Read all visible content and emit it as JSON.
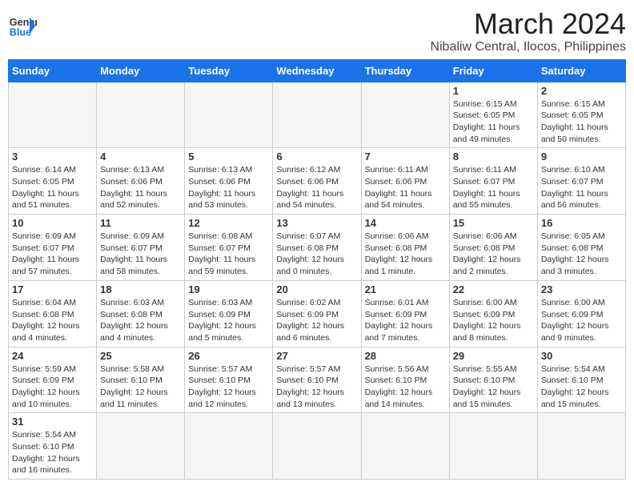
{
  "header": {
    "logo_general": "General",
    "logo_blue": "Blue",
    "month_year": "March 2024",
    "location": "Nibaliw Central, Ilocos, Philippines"
  },
  "weekdays": [
    "Sunday",
    "Monday",
    "Tuesday",
    "Wednesday",
    "Thursday",
    "Friday",
    "Saturday"
  ],
  "days": [
    {
      "num": "",
      "sunrise": "",
      "sunset": "",
      "daylight": "",
      "empty": true
    },
    {
      "num": "",
      "sunrise": "",
      "sunset": "",
      "daylight": "",
      "empty": true
    },
    {
      "num": "",
      "sunrise": "",
      "sunset": "",
      "daylight": "",
      "empty": true
    },
    {
      "num": "",
      "sunrise": "",
      "sunset": "",
      "daylight": "",
      "empty": true
    },
    {
      "num": "",
      "sunrise": "",
      "sunset": "",
      "daylight": "",
      "empty": true
    },
    {
      "num": "1",
      "sunrise": "Sunrise: 6:15 AM",
      "sunset": "Sunset: 6:05 PM",
      "daylight": "Daylight: 11 hours and 49 minutes."
    },
    {
      "num": "2",
      "sunrise": "Sunrise: 6:15 AM",
      "sunset": "Sunset: 6:05 PM",
      "daylight": "Daylight: 11 hours and 50 minutes."
    },
    {
      "num": "3",
      "sunrise": "Sunrise: 6:14 AM",
      "sunset": "Sunset: 6:05 PM",
      "daylight": "Daylight: 11 hours and 51 minutes."
    },
    {
      "num": "4",
      "sunrise": "Sunrise: 6:13 AM",
      "sunset": "Sunset: 6:06 PM",
      "daylight": "Daylight: 11 hours and 52 minutes."
    },
    {
      "num": "5",
      "sunrise": "Sunrise: 6:13 AM",
      "sunset": "Sunset: 6:06 PM",
      "daylight": "Daylight: 11 hours and 53 minutes."
    },
    {
      "num": "6",
      "sunrise": "Sunrise: 6:12 AM",
      "sunset": "Sunset: 6:06 PM",
      "daylight": "Daylight: 11 hours and 54 minutes."
    },
    {
      "num": "7",
      "sunrise": "Sunrise: 6:11 AM",
      "sunset": "Sunset: 6:06 PM",
      "daylight": "Daylight: 11 hours and 54 minutes."
    },
    {
      "num": "8",
      "sunrise": "Sunrise: 6:11 AM",
      "sunset": "Sunset: 6:07 PM",
      "daylight": "Daylight: 11 hours and 55 minutes."
    },
    {
      "num": "9",
      "sunrise": "Sunrise: 6:10 AM",
      "sunset": "Sunset: 6:07 PM",
      "daylight": "Daylight: 11 hours and 56 minutes."
    },
    {
      "num": "10",
      "sunrise": "Sunrise: 6:09 AM",
      "sunset": "Sunset: 6:07 PM",
      "daylight": "Daylight: 11 hours and 57 minutes."
    },
    {
      "num": "11",
      "sunrise": "Sunrise: 6:09 AM",
      "sunset": "Sunset: 6:07 PM",
      "daylight": "Daylight: 11 hours and 58 minutes."
    },
    {
      "num": "12",
      "sunrise": "Sunrise: 6:08 AM",
      "sunset": "Sunset: 6:07 PM",
      "daylight": "Daylight: 11 hours and 59 minutes."
    },
    {
      "num": "13",
      "sunrise": "Sunrise: 6:07 AM",
      "sunset": "Sunset: 6:08 PM",
      "daylight": "Daylight: 12 hours and 0 minutes."
    },
    {
      "num": "14",
      "sunrise": "Sunrise: 6:06 AM",
      "sunset": "Sunset: 6:08 PM",
      "daylight": "Daylight: 12 hours and 1 minute."
    },
    {
      "num": "15",
      "sunrise": "Sunrise: 6:06 AM",
      "sunset": "Sunset: 6:08 PM",
      "daylight": "Daylight: 12 hours and 2 minutes."
    },
    {
      "num": "16",
      "sunrise": "Sunrise: 6:05 AM",
      "sunset": "Sunset: 6:08 PM",
      "daylight": "Daylight: 12 hours and 3 minutes."
    },
    {
      "num": "17",
      "sunrise": "Sunrise: 6:04 AM",
      "sunset": "Sunset: 6:08 PM",
      "daylight": "Daylight: 12 hours and 4 minutes."
    },
    {
      "num": "18",
      "sunrise": "Sunrise: 6:03 AM",
      "sunset": "Sunset: 6:08 PM",
      "daylight": "Daylight: 12 hours and 4 minutes."
    },
    {
      "num": "19",
      "sunrise": "Sunrise: 6:03 AM",
      "sunset": "Sunset: 6:09 PM",
      "daylight": "Daylight: 12 hours and 5 minutes."
    },
    {
      "num": "20",
      "sunrise": "Sunrise: 6:02 AM",
      "sunset": "Sunset: 6:09 PM",
      "daylight": "Daylight: 12 hours and 6 minutes."
    },
    {
      "num": "21",
      "sunrise": "Sunrise: 6:01 AM",
      "sunset": "Sunset: 6:09 PM",
      "daylight": "Daylight: 12 hours and 7 minutes."
    },
    {
      "num": "22",
      "sunrise": "Sunrise: 6:00 AM",
      "sunset": "Sunset: 6:09 PM",
      "daylight": "Daylight: 12 hours and 8 minutes."
    },
    {
      "num": "23",
      "sunrise": "Sunrise: 6:00 AM",
      "sunset": "Sunset: 6:09 PM",
      "daylight": "Daylight: 12 hours and 9 minutes."
    },
    {
      "num": "24",
      "sunrise": "Sunrise: 5:59 AM",
      "sunset": "Sunset: 6:09 PM",
      "daylight": "Daylight: 12 hours and 10 minutes."
    },
    {
      "num": "25",
      "sunrise": "Sunrise: 5:58 AM",
      "sunset": "Sunset: 6:10 PM",
      "daylight": "Daylight: 12 hours and 11 minutes."
    },
    {
      "num": "26",
      "sunrise": "Sunrise: 5:57 AM",
      "sunset": "Sunset: 6:10 PM",
      "daylight": "Daylight: 12 hours and 12 minutes."
    },
    {
      "num": "27",
      "sunrise": "Sunrise: 5:57 AM",
      "sunset": "Sunset: 6:10 PM",
      "daylight": "Daylight: 12 hours and 13 minutes."
    },
    {
      "num": "28",
      "sunrise": "Sunrise: 5:56 AM",
      "sunset": "Sunset: 6:10 PM",
      "daylight": "Daylight: 12 hours and 14 minutes."
    },
    {
      "num": "29",
      "sunrise": "Sunrise: 5:55 AM",
      "sunset": "Sunset: 6:10 PM",
      "daylight": "Daylight: 12 hours and 15 minutes."
    },
    {
      "num": "30",
      "sunrise": "Sunrise: 5:54 AM",
      "sunset": "Sunset: 6:10 PM",
      "daylight": "Daylight: 12 hours and 15 minutes."
    },
    {
      "num": "31",
      "sunrise": "Sunrise: 5:54 AM",
      "sunset": "Sunset: 6:10 PM",
      "daylight": "Daylight: 12 hours and 16 minutes."
    },
    {
      "num": "",
      "empty": true
    },
    {
      "num": "",
      "empty": true
    },
    {
      "num": "",
      "empty": true
    },
    {
      "num": "",
      "empty": true
    },
    {
      "num": "",
      "empty": true
    },
    {
      "num": "",
      "empty": true
    }
  ]
}
